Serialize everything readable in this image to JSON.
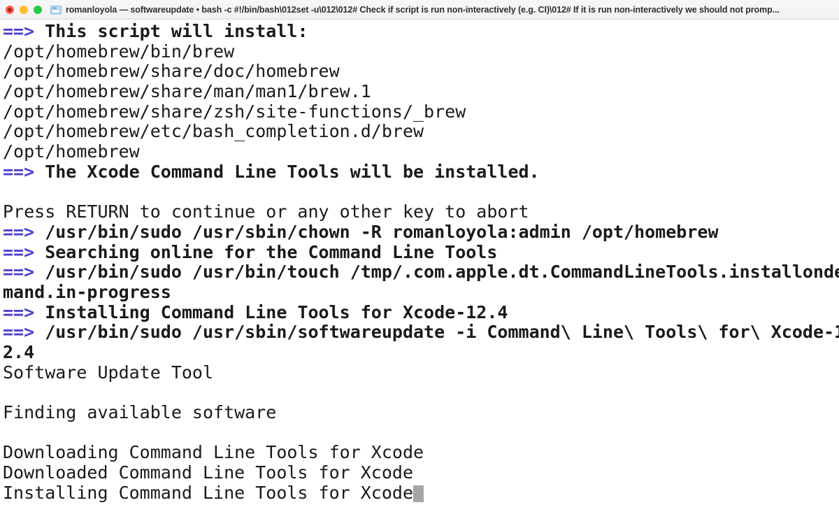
{
  "window": {
    "title": "romanloyola — softwareupdate • bash -c #!/bin/bash\\012set -u\\012\\012# Check if script is run non-interactively (e.g. CI)\\012# If it is run non-interactively we should not promp...",
    "icon": "folder-icon",
    "controls": {
      "close": "close-button",
      "minimize": "minimize-button",
      "maximize": "maximize-button"
    },
    "colors": {
      "close": "#ff5f57",
      "minimize": "#febc2e",
      "maximize": "#28c840",
      "titlebar_bg": "#f3f3f3",
      "terminal_bg": "#ffffff",
      "text": "#1a1a1a",
      "arrow": "#4b3fcf",
      "cursor": "#a6a6a6"
    }
  },
  "terminal": {
    "prompt_marker": "==>",
    "cursor_glyph": "block-cursor",
    "lines": [
      {
        "marker": true,
        "bold": true,
        "text": " This script will install:"
      },
      {
        "marker": false,
        "bold": false,
        "text": "/opt/homebrew/bin/brew"
      },
      {
        "marker": false,
        "bold": false,
        "text": "/opt/homebrew/share/doc/homebrew"
      },
      {
        "marker": false,
        "bold": false,
        "text": "/opt/homebrew/share/man/man1/brew.1"
      },
      {
        "marker": false,
        "bold": false,
        "text": "/opt/homebrew/share/zsh/site-functions/_brew"
      },
      {
        "marker": false,
        "bold": false,
        "text": "/opt/homebrew/etc/bash_completion.d/brew"
      },
      {
        "marker": false,
        "bold": false,
        "text": "/opt/homebrew"
      },
      {
        "marker": true,
        "bold": true,
        "text": " The Xcode Command Line Tools will be installed."
      },
      {
        "marker": false,
        "bold": false,
        "text": ""
      },
      {
        "marker": false,
        "bold": false,
        "text": "Press RETURN to continue or any other key to abort"
      },
      {
        "marker": true,
        "bold": true,
        "text": " /usr/bin/sudo /usr/sbin/chown -R romanloyola:admin /opt/homebrew"
      },
      {
        "marker": true,
        "bold": true,
        "text": " Searching online for the Command Line Tools"
      },
      {
        "marker": true,
        "bold": true,
        "text": " /usr/bin/sudo /usr/bin/touch /tmp/.com.apple.dt.CommandLineTools.installonde"
      },
      {
        "marker": false,
        "bold": true,
        "text": "mand.in-progress"
      },
      {
        "marker": true,
        "bold": true,
        "text": " Installing Command Line Tools for Xcode-12.4"
      },
      {
        "marker": true,
        "bold": true,
        "text": " /usr/bin/sudo /usr/sbin/softwareupdate -i Command\\ Line\\ Tools\\ for\\ Xcode-1"
      },
      {
        "marker": false,
        "bold": true,
        "text": "2.4"
      },
      {
        "marker": false,
        "bold": false,
        "text": "Software Update Tool"
      },
      {
        "marker": false,
        "bold": false,
        "text": ""
      },
      {
        "marker": false,
        "bold": false,
        "text": "Finding available software"
      },
      {
        "marker": false,
        "bold": false,
        "text": ""
      },
      {
        "marker": false,
        "bold": false,
        "text": "Downloading Command Line Tools for Xcode"
      },
      {
        "marker": false,
        "bold": false,
        "text": "Downloaded Command Line Tools for Xcode"
      },
      {
        "marker": false,
        "bold": false,
        "text": "Installing Command Line Tools for Xcode",
        "cursor": true
      }
    ]
  }
}
